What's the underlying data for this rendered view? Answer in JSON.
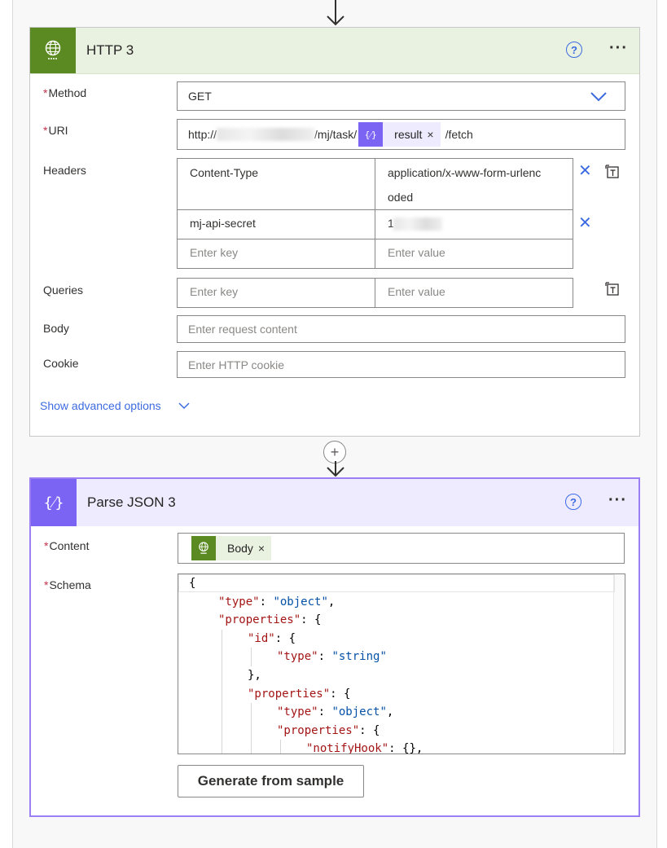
{
  "http_card": {
    "title": "HTTP 3",
    "help_icon": "?",
    "more_icon": "···",
    "method": {
      "label": "Method",
      "value": "GET"
    },
    "uri": {
      "label": "URI",
      "prefix": "http://",
      "suffix_visible": "/mj/task/",
      "token_label": "result",
      "token_close": "×",
      "tail": "/fetch"
    },
    "headers": {
      "label": "Headers",
      "rows": [
        {
          "key": "Content-Type",
          "value_line1": "application/x-www-form-urlenc",
          "value_line2": "oded"
        },
        {
          "key": "mj-api-secret",
          "value": "1"
        }
      ],
      "key_placeholder": "Enter key",
      "value_placeholder": "Enter value"
    },
    "queries": {
      "label": "Queries",
      "key_placeholder": "Enter key",
      "value_placeholder": "Enter value"
    },
    "body": {
      "label": "Body",
      "placeholder": "Enter request content"
    },
    "cookie": {
      "label": "Cookie",
      "placeholder": "Enter HTTP cookie"
    },
    "advanced_link": "Show advanced options"
  },
  "parse_card": {
    "title": "Parse JSON 3",
    "help_icon": "?",
    "more_icon": "···",
    "content": {
      "label": "Content",
      "token_label": "Body",
      "token_close": "×"
    },
    "schema": {
      "label": "Schema",
      "lines": [
        {
          "indent": 0,
          "parts": [
            [
              "p",
              "{"
            ]
          ]
        },
        {
          "indent": 1,
          "parts": [
            [
              "k",
              "\"type\""
            ],
            [
              "p",
              ": "
            ],
            [
              "s",
              "\"object\""
            ],
            [
              "p",
              ","
            ]
          ]
        },
        {
          "indent": 1,
          "parts": [
            [
              "k",
              "\"properties\""
            ],
            [
              "p",
              ": {"
            ]
          ]
        },
        {
          "indent": 2,
          "parts": [
            [
              "k",
              "\"id\""
            ],
            [
              "p",
              ": {"
            ]
          ]
        },
        {
          "indent": 3,
          "parts": [
            [
              "k",
              "\"type\""
            ],
            [
              "p",
              ": "
            ],
            [
              "s",
              "\"string\""
            ]
          ]
        },
        {
          "indent": 2,
          "parts": [
            [
              "p",
              "},"
            ]
          ]
        },
        {
          "indent": 2,
          "parts": [
            [
              "k",
              "\"properties\""
            ],
            [
              "p",
              ": {"
            ]
          ]
        },
        {
          "indent": 3,
          "parts": [
            [
              "k",
              "\"type\""
            ],
            [
              "p",
              ": "
            ],
            [
              "s",
              "\"object\""
            ],
            [
              "p",
              ","
            ]
          ]
        },
        {
          "indent": 3,
          "parts": [
            [
              "k",
              "\"properties\""
            ],
            [
              "p",
              ": {"
            ]
          ]
        },
        {
          "indent": 4,
          "parts": [
            [
              "k",
              "\"notifyHook\""
            ],
            [
              "p",
              ": {},"
            ]
          ]
        }
      ]
    },
    "generate_button": "Generate from sample"
  },
  "add_step_icon": "+",
  "colors": {
    "http_accent": "#5b8a23",
    "parse_accent": "#7b63f4",
    "link": "#3d6be0",
    "required": "#c4314b"
  }
}
